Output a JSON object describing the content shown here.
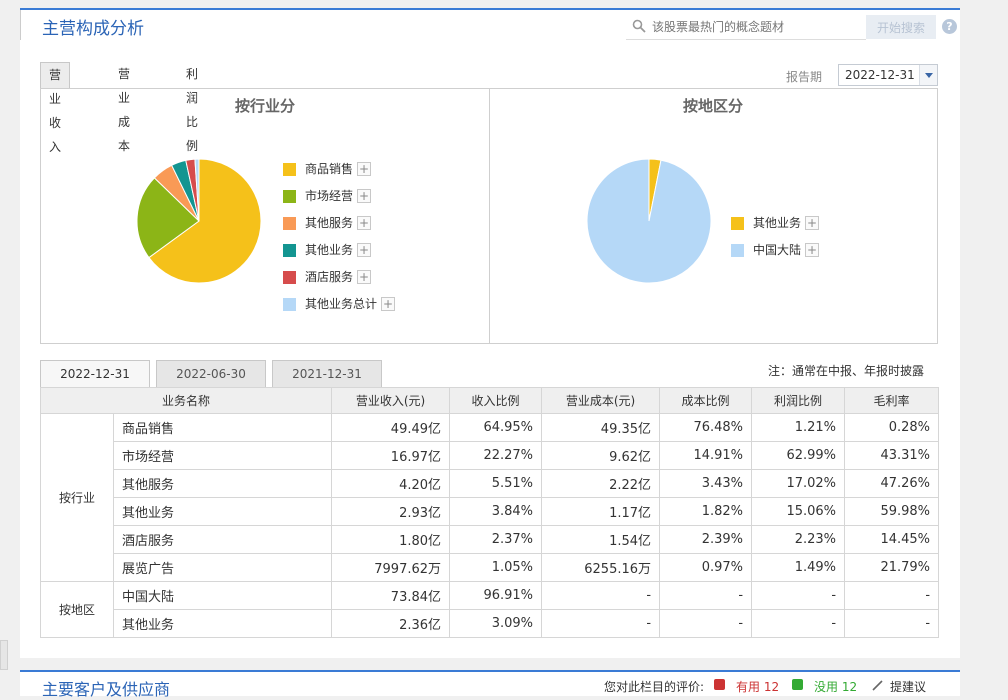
{
  "header": {
    "title": "主营构成分析",
    "search_placeholder": "该股票最热门的概念题材",
    "search_button": "开始搜索",
    "help": "?"
  },
  "chart_tabs": [
    "营业收入",
    "营业成本",
    "利润比例"
  ],
  "report": {
    "label": "报告期",
    "value": "2022-12-31"
  },
  "chart_data": [
    {
      "type": "pie",
      "title": "按行业分",
      "labels": [
        "商品销售",
        "市场经营",
        "其他服务",
        "其他业务",
        "酒店服务",
        "其他业务总计"
      ],
      "values": [
        64.95,
        22.27,
        5.51,
        3.84,
        2.37,
        1.05
      ],
      "colors": [
        "#f5c11a",
        "#8cb517",
        "#f99a56",
        "#139591",
        "#d64c4c",
        "#b5d8f7"
      ]
    },
    {
      "type": "pie",
      "title": "按地区分",
      "labels": [
        "其他业务",
        "中国大陆"
      ],
      "values": [
        3.09,
        96.91
      ],
      "colors": [
        "#f5c11a",
        "#b5d8f7"
      ]
    }
  ],
  "period_tabs": [
    "2022-12-31",
    "2022-06-30",
    "2021-12-31"
  ],
  "note": "注：通常在中报、年报时披露",
  "table": {
    "headers": [
      "业务名称",
      "营业收入(元)",
      "收入比例",
      "营业成本(元)",
      "成本比例",
      "利润比例",
      "毛利率"
    ],
    "groups": [
      {
        "name": "按行业",
        "rows": [
          [
            "商品销售",
            "49.49亿",
            "64.95%",
            "49.35亿",
            "76.48%",
            "1.21%",
            "0.28%"
          ],
          [
            "市场经营",
            "16.97亿",
            "22.27%",
            "9.62亿",
            "14.91%",
            "62.99%",
            "43.31%"
          ],
          [
            "其他服务",
            "4.20亿",
            "5.51%",
            "2.22亿",
            "3.43%",
            "17.02%",
            "47.26%"
          ],
          [
            "其他业务",
            "2.93亿",
            "3.84%",
            "1.17亿",
            "1.82%",
            "15.06%",
            "59.98%"
          ],
          [
            "酒店服务",
            "1.80亿",
            "2.37%",
            "1.54亿",
            "2.39%",
            "2.23%",
            "14.45%"
          ],
          [
            "展览广告",
            "7997.62万",
            "1.05%",
            "6255.16万",
            "0.97%",
            "1.49%",
            "21.79%"
          ]
        ]
      },
      {
        "name": "按地区",
        "rows": [
          [
            "中国大陆",
            "73.84亿",
            "96.91%",
            "-",
            "-",
            "-",
            "-"
          ],
          [
            "其他业务",
            "2.36亿",
            "3.09%",
            "-",
            "-",
            "-",
            "-"
          ]
        ]
      }
    ]
  },
  "bottom": {
    "title": "主要客户及供应商",
    "rating_label": "您对此栏目的评价:",
    "useful_label": "有用 12",
    "useless_label": "没用 12",
    "suggest_label": "提建议"
  }
}
